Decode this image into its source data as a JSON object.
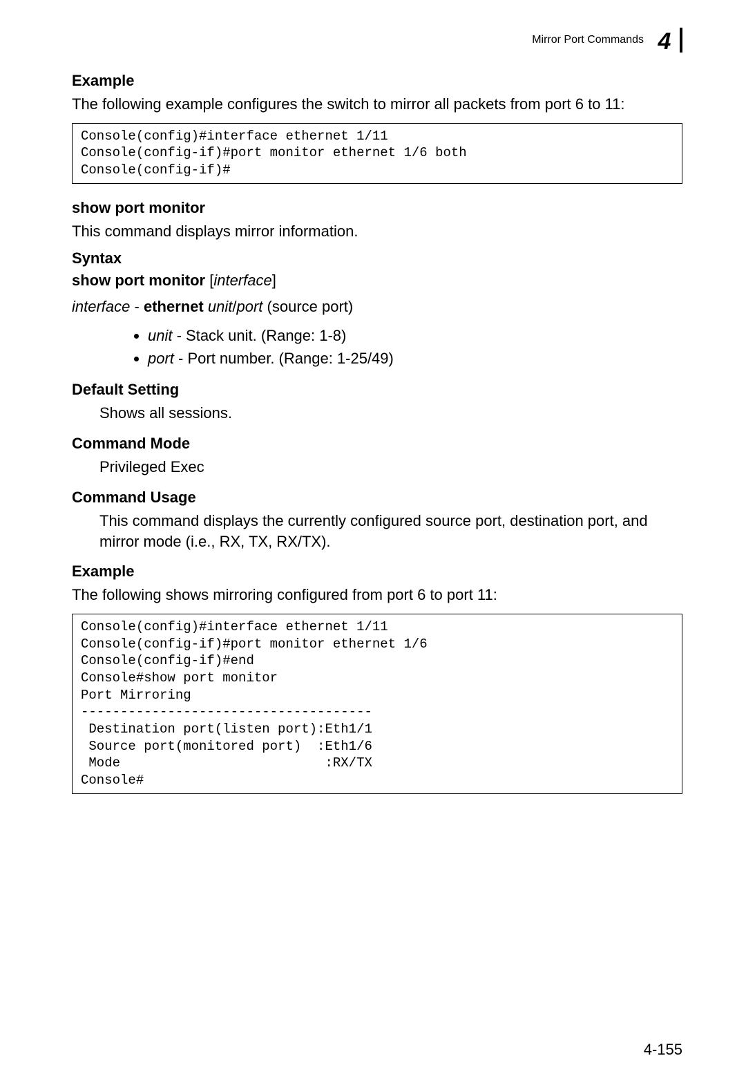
{
  "header": {
    "title": "Mirror Port Commands",
    "chapter_number": "4"
  },
  "sections": {
    "example1_head": "Example",
    "example1_text": "The following example configures the switch to mirror all packets from port 6 to 11:",
    "code1": "Console(config)#interface ethernet 1/11\nConsole(config-if)#port monitor ethernet 1/6 both\nConsole(config-if)#",
    "cmd_name": "show port monitor",
    "cmd_desc": "This command displays mirror information.",
    "syntax_head": "Syntax",
    "syntax_main_bold": "show port monitor",
    "syntax_main_bracket_open": " [",
    "syntax_main_italic": "interface",
    "syntax_main_bracket_close": "]",
    "syntax_sub_italic1": "interface",
    "syntax_sub_sep": " - ",
    "syntax_sub_bold": "ethernet",
    "syntax_sub_space": " ",
    "syntax_sub_italic2": "unit",
    "syntax_sub_slash": "/",
    "syntax_sub_italic3": "port",
    "syntax_sub_tail": " (source port)",
    "bullet1_italic": "unit",
    "bullet1_text": " - Stack unit. (Range: 1-8)",
    "bullet2_italic": "port",
    "bullet2_text": " - Port number. (Range: 1-25/49)",
    "default_head": "Default Setting",
    "default_text": "Shows all sessions.",
    "mode_head": "Command Mode",
    "mode_text": "Privileged Exec",
    "usage_head": "Command Usage",
    "usage_text": "This command displays the currently configured source port, destination port, and mirror mode (i.e., RX, TX, RX/TX).",
    "example2_head": "Example",
    "example2_text": "The following shows mirroring configured from port 6 to port 11:",
    "code2": "Console(config)#interface ethernet 1/11\nConsole(config-if)#port monitor ethernet 1/6\nConsole(config-if)#end\nConsole#show port monitor\nPort Mirroring\n-------------------------------------\n Destination port(listen port):Eth1/1\n Source port(monitored port)  :Eth1/6\n Mode                          :RX/TX\nConsole#"
  },
  "page_number": "4-155"
}
